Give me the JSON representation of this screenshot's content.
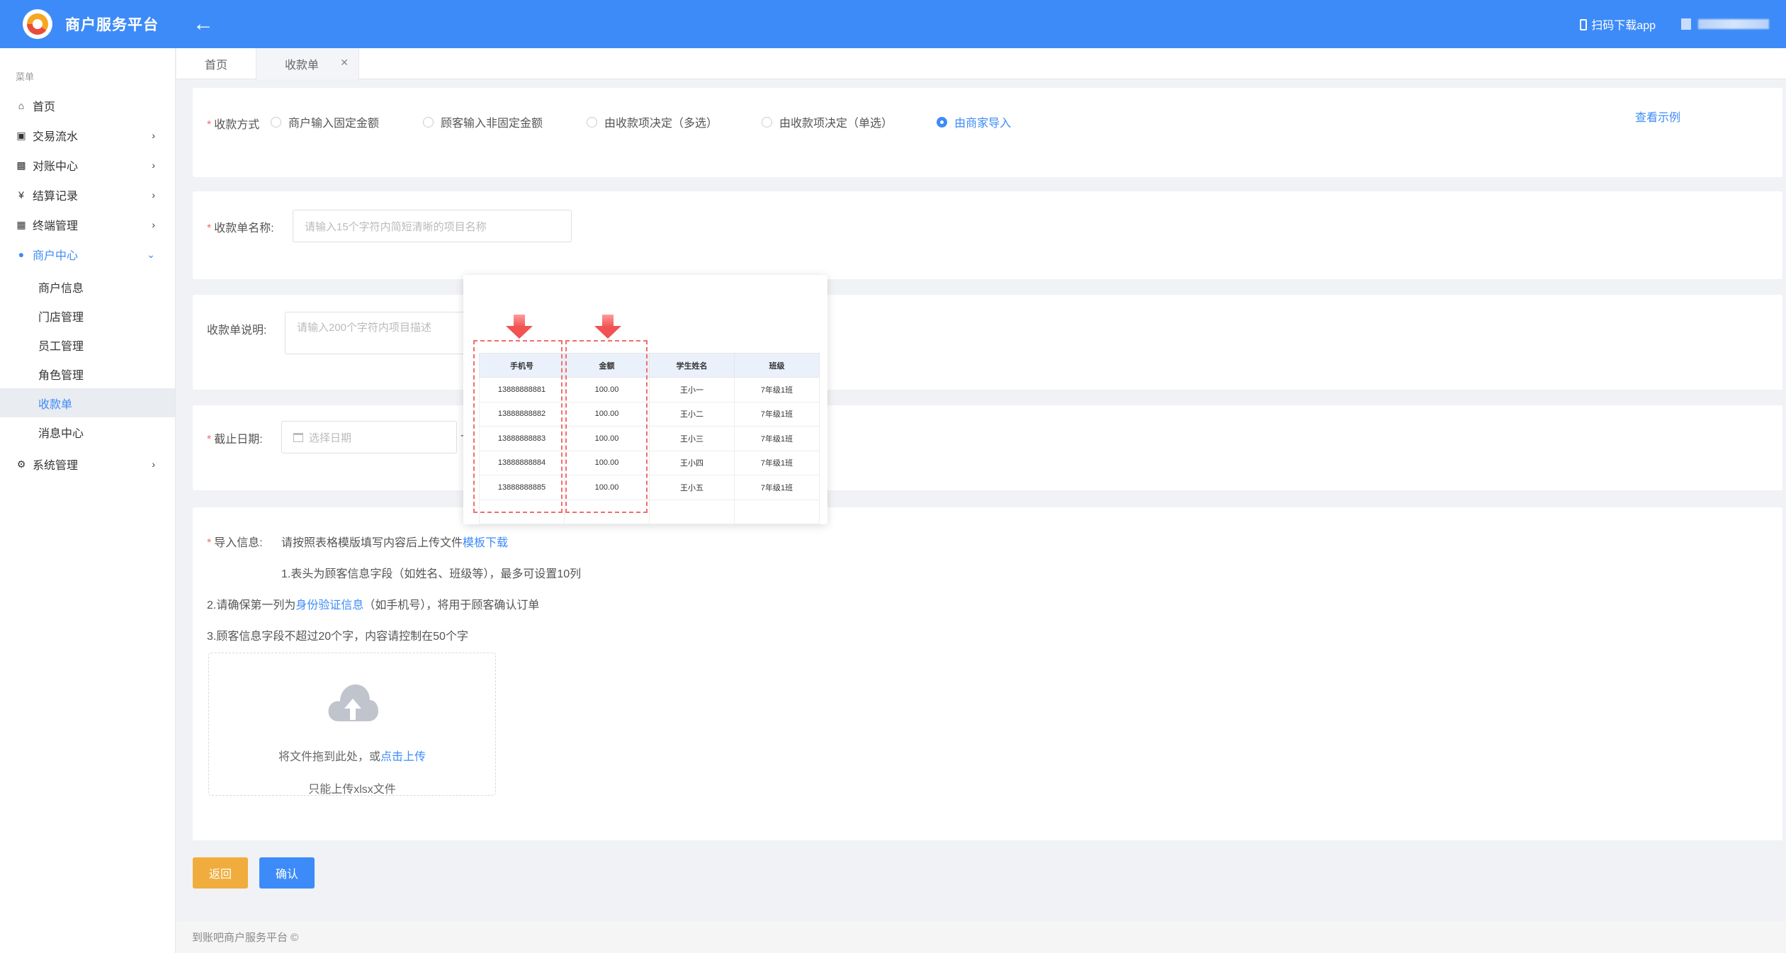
{
  "header": {
    "title": "商户服务平台",
    "download_app": "扫码下载app"
  },
  "sidebar": {
    "menu_title": "菜单",
    "items": [
      {
        "label": "首页",
        "icon": "home-icon"
      },
      {
        "label": "交易流水",
        "icon": "money-icon"
      },
      {
        "label": "对账中心",
        "icon": "bar-chart-icon"
      },
      {
        "label": "结算记录",
        "icon": "yen-icon"
      },
      {
        "label": "终端管理",
        "icon": "calculator-icon"
      },
      {
        "label": "商户中心",
        "icon": "user-icon"
      },
      {
        "label": "系统管理",
        "icon": "gear-icon"
      }
    ],
    "sub_items": [
      "商户信息",
      "门店管理",
      "员工管理",
      "角色管理",
      "收款单",
      "消息中心"
    ]
  },
  "tabs": [
    "首页",
    "收款单"
  ],
  "form": {
    "payment_method_label": "收款方式",
    "payment_methods": [
      "商户输入固定金额",
      "顾客输入非固定金额",
      "由收款项决定（多选）",
      "由收款项决定（单选）",
      "由商家导入"
    ],
    "view_example": "查看示例",
    "name_label": "收款单名称:",
    "name_placeholder": "请输入15个字符内简短清晰的项目名称",
    "desc_label": "收款单说明:",
    "desc_placeholder": "请输入200个字符内项目描述",
    "deadline_label": "截止日期:",
    "date_placeholder": "选择日期",
    "date_sep": "-",
    "import_label": "导入信息:",
    "import_hint": "请按照表格模版填写内容后上传文件",
    "template_download": "模板下载",
    "rule1": "1.表头为顾客信息字段（如姓名、班级等），最多可设置10列",
    "rule2_prefix": "2.请确保第一列为",
    "rule2_link": "身份验证信息",
    "rule2_suffix": "（如手机号），将用于顾客确认订单",
    "rule3": "3.顾客信息字段不超过20个字，内容请控制在50个字",
    "upload_drag": "将文件拖到此处，或",
    "upload_click": "点击上传",
    "upload_tip": "只能上传xlsx文件"
  },
  "example_table": {
    "headers": [
      "手机号",
      "金额",
      "学生姓名",
      "班级"
    ],
    "rows": [
      [
        "13888888881",
        "100.00",
        "王小一",
        "7年级1班"
      ],
      [
        "13888888882",
        "100.00",
        "王小二",
        "7年级1班"
      ],
      [
        "13888888883",
        "100.00",
        "王小三",
        "7年级1班"
      ],
      [
        "13888888884",
        "100.00",
        "王小四",
        "7年级1班"
      ],
      [
        "13888888885",
        "100.00",
        "王小五",
        "7年级1班"
      ]
    ]
  },
  "buttons": {
    "back": "返回",
    "confirm": "确认"
  },
  "footer": "到账吧商户服务平台 ©",
  "colors": {
    "primary": "#3d8bf8",
    "warning": "#f0ad3d",
    "danger": "#f56c6c"
  }
}
